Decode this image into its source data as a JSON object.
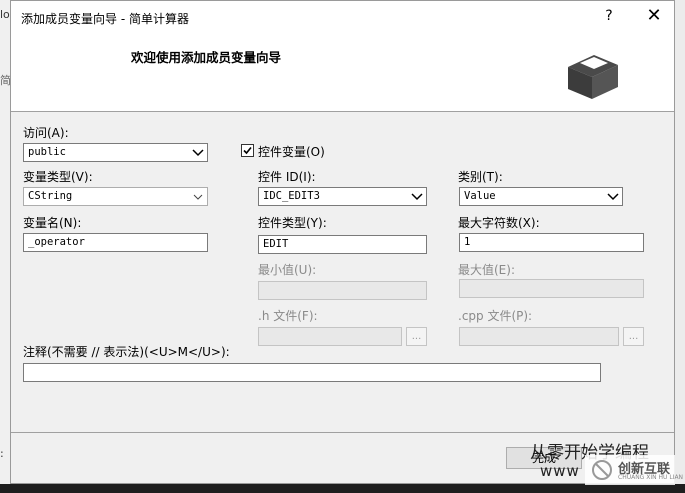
{
  "background": {
    "left_top": "lo",
    "left_mid": "简",
    "left_bottom": ":"
  },
  "dialog": {
    "title": "添加成员变量向导 - 简单计算器",
    "help_label": "?",
    "close_label": "✕",
    "header_title": "欢迎使用添加成员变量向导",
    "header_icon": "wizard-box-icon"
  },
  "form": {
    "access": {
      "label": "访问(A):",
      "value": "public"
    },
    "control_var": {
      "label": "控件变量(O)",
      "checked": true
    },
    "var_type": {
      "label": "变量类型(V):",
      "value": "CString"
    },
    "control_id": {
      "label": "控件 ID(I):",
      "value": "IDC_EDIT3"
    },
    "category": {
      "label": "类别(T):",
      "value": "Value"
    },
    "var_name": {
      "label": "变量名(N):",
      "value": "_operator"
    },
    "control_type": {
      "label": "控件类型(Y):",
      "value": "EDIT"
    },
    "max_chars": {
      "label": "最大字符数(X):",
      "value": "1"
    },
    "min_value": {
      "label": "最小值(U):",
      "value": ""
    },
    "max_value": {
      "label": "最大值(E):",
      "value": ""
    },
    "h_file": {
      "label": ".h 文件(F):",
      "value": "",
      "browse": "..."
    },
    "cpp_file": {
      "label": ".cpp 文件(P):",
      "value": "",
      "browse": "..."
    },
    "comment": {
      "label": "注释(不需要 // 表示法)(<U>M</U>):",
      "value": ""
    }
  },
  "buttons": {
    "finish": "完成"
  },
  "watermark": {
    "line1": "从零开始学编程",
    "line2": "www",
    "logo_text": "创新互联",
    "logo_sub": "CHUANG XIN HU LIAN"
  },
  "colors": {
    "dialog_bg": "#f0f0f0",
    "header_bg": "#ffffff",
    "disabled_text": "#8a8a8a"
  }
}
